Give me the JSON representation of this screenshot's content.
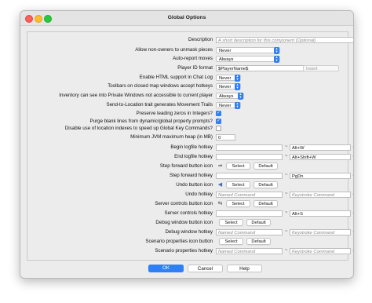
{
  "window": {
    "title": "Global Options"
  },
  "rows": {
    "description": {
      "label": "Description",
      "placeholder": "A short description for this component (Optional)"
    },
    "allow_nonowners": {
      "label": "Allow non-owners to unmask pieces",
      "value": "Never"
    },
    "autoreport": {
      "label": "Auto-report moves",
      "value": "Always"
    },
    "player_id": {
      "label": "Player ID format",
      "value": "$PlayerName$",
      "insert": "Insert"
    },
    "html_chat": {
      "label": "Enable HTML support in Chat Log",
      "value": "Never"
    },
    "toolbars": {
      "label": "Toolbars on closed map windows accept hotkeys",
      "value": "Never"
    },
    "inventory": {
      "label": "Inventory can see into Private Windows not accessible to current player",
      "value": "Always"
    },
    "send_location": {
      "label": "Send-to-Location trait generates Movement Trails",
      "value": "Never"
    },
    "leading_zeros": {
      "label": "Preserve leading zeros in Integers?",
      "checked": true
    },
    "purge_blank": {
      "label": "Purge blank lines from dynamic/global property prompts?",
      "checked": true
    },
    "disable_indexes": {
      "label": "Disable use of location indexes to speed up Global Key Commands?",
      "checked": false
    },
    "jvm_heap": {
      "label": "Minimum JVM maximum heap (in MB)",
      "value": "0"
    },
    "begin_log": {
      "label": "Begin logfile hotkey",
      "keystroke": "Alt+W"
    },
    "end_log": {
      "label": "End logfile hotkey",
      "keystroke": "Alt+Shift+W"
    },
    "step_fwd_icon": {
      "label": "Step forward button icon",
      "select": "Select",
      "default": "Default"
    },
    "step_fwd_hotkey": {
      "label": "Step forward hotkey",
      "keystroke": "PgDn"
    },
    "undo_icon": {
      "label": "Undo button icon",
      "select": "Select",
      "default": "Default"
    },
    "undo_hotkey": {
      "label": "Undo hotkey",
      "named_placeholder": "Named Command",
      "keystroke_placeholder": "Keystroke Command"
    },
    "server_icon": {
      "label": "Server controls button icon",
      "select": "Select",
      "default": "Default"
    },
    "server_hotkey": {
      "label": "Server controls hotkey",
      "keystroke": "Alt+S"
    },
    "debug_icon": {
      "label": "Debug window button icon",
      "select": "Select",
      "default": "Default"
    },
    "debug_hotkey": {
      "label": "Debug window hotkey",
      "named_placeholder": "Named Command",
      "keystroke_placeholder": "Keystroke Command"
    },
    "scenario_icon": {
      "label": "Scenario properties icon button",
      "select": "Select",
      "default": "Default"
    },
    "scenario_hotkey": {
      "label": "Scenario properties hotkey",
      "named_placeholder": "Named Command",
      "keystroke_placeholder": "Keystroke Command"
    }
  },
  "footer": {
    "ok": "OK",
    "cancel": "Cancel",
    "help": "Help"
  },
  "colors": {
    "accent": "#2f7ff6",
    "window_bg": "#ececec"
  }
}
